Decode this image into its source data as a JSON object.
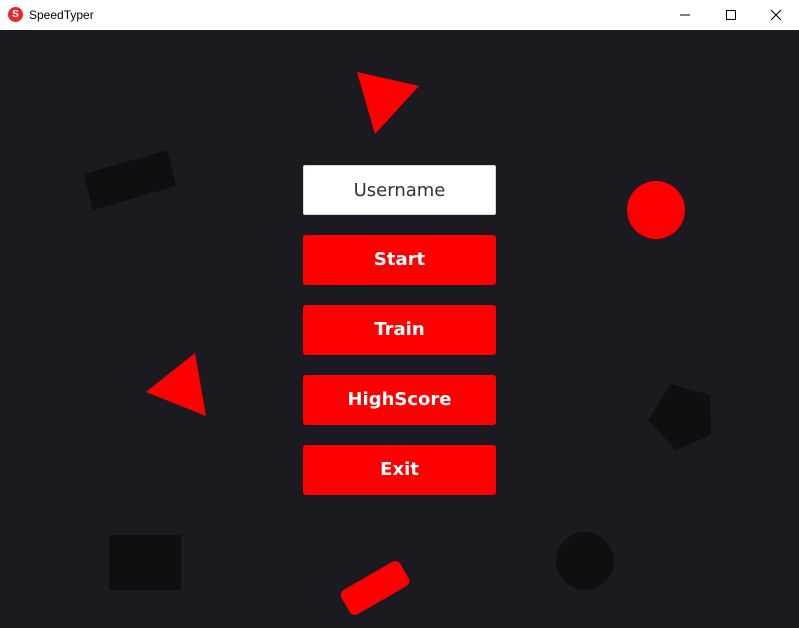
{
  "window": {
    "title": "SpeedTyper",
    "icon_letter": "S",
    "icon_color": "#e8262b"
  },
  "menu": {
    "username_placeholder": "Username",
    "username_value": "",
    "buttons": {
      "start": "Start",
      "train": "Train",
      "highscore": "HighScore",
      "exit": "Exit"
    }
  },
  "colors": {
    "background": "#1b1a21",
    "accent": "#ff0000",
    "dark_shape": "#0f0f11"
  },
  "icons": [
    "minimize-icon",
    "maximize-icon",
    "close-icon"
  ]
}
